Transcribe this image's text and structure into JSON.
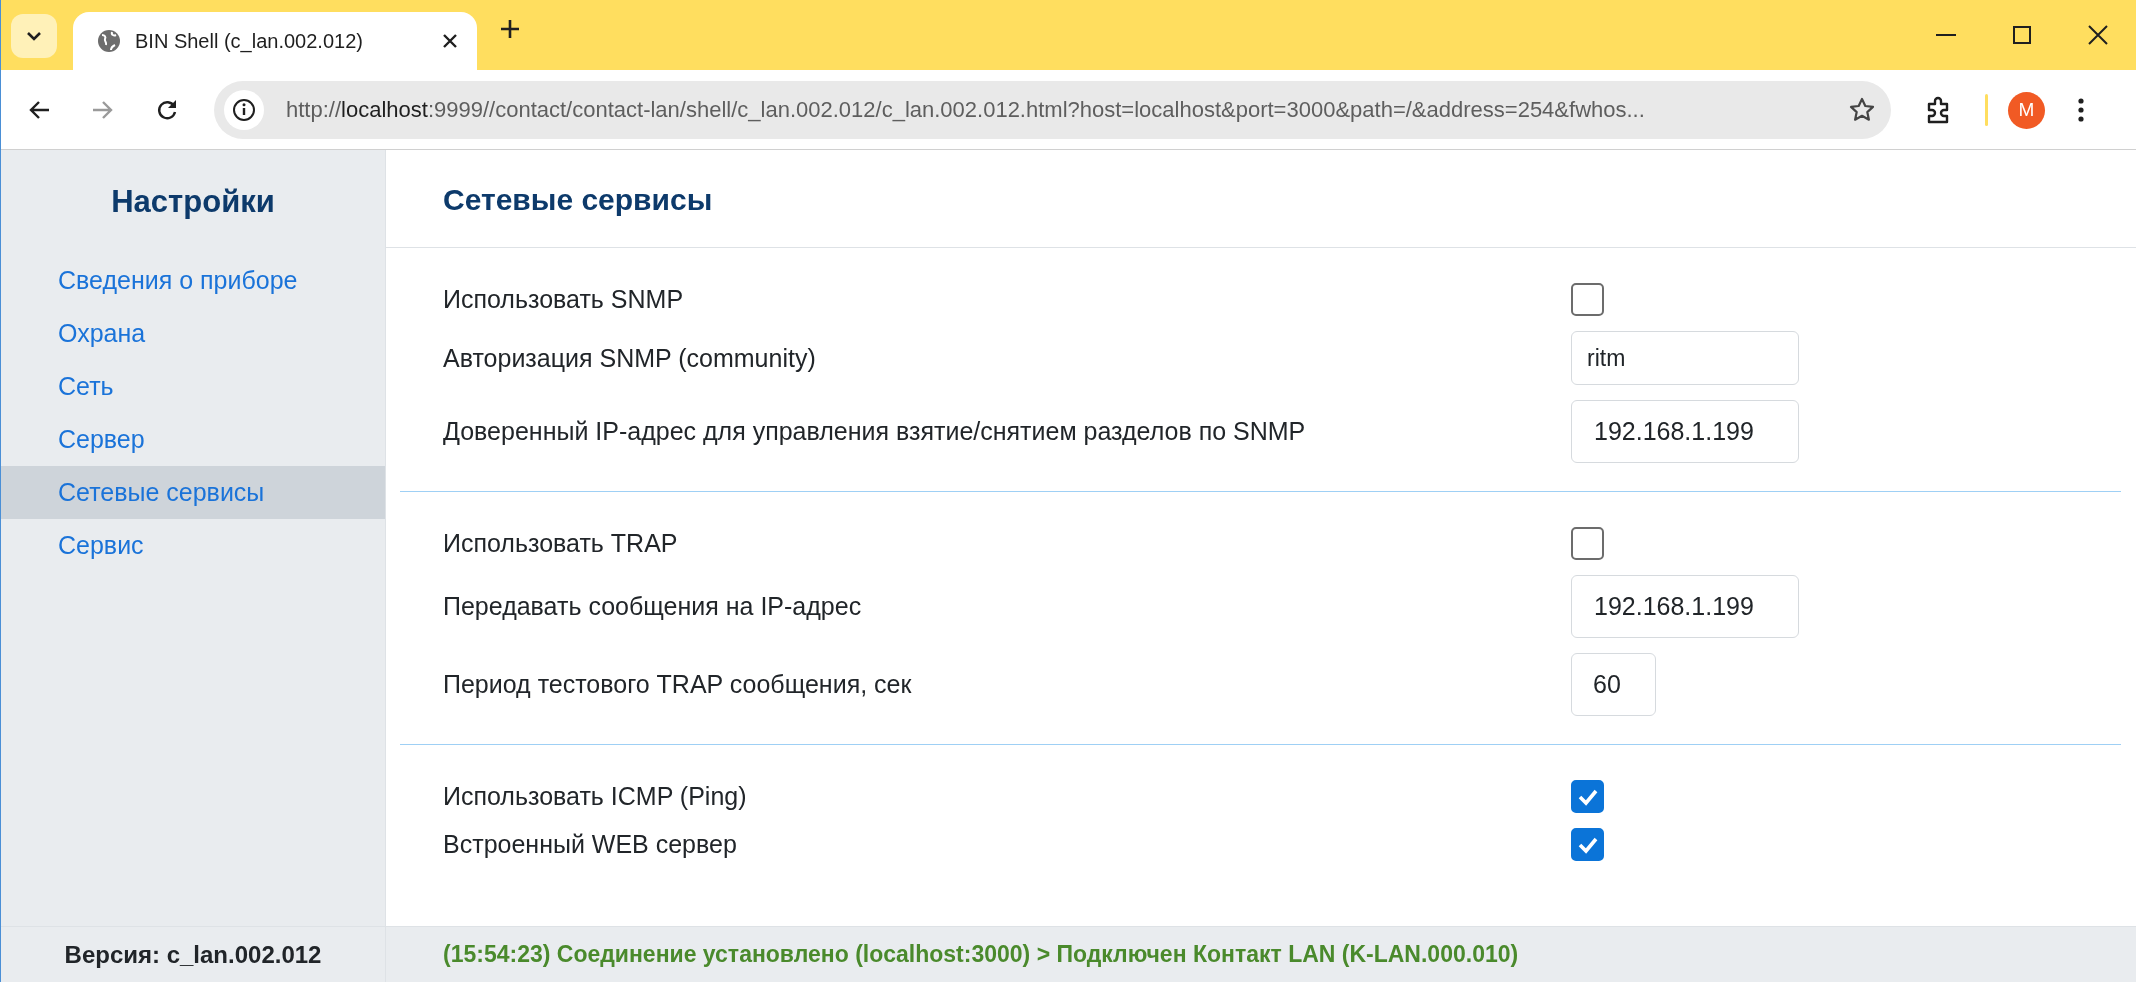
{
  "browser": {
    "tab_title": "BIN Shell (c_lan.002.012)",
    "address": {
      "scheme": "http://",
      "host": "localhost",
      "rest": ":9999//contact/contact-lan/shell/c_lan.002.012/c_lan.002.012.html?host=localhost&port=3000&path=/&address=254&fwhos..."
    },
    "forward_disabled": true,
    "avatar": "M"
  },
  "sidebar": {
    "title": "Настройки",
    "items": [
      {
        "label": "Сведения о приборе",
        "selected": false
      },
      {
        "label": "Охрана",
        "selected": false
      },
      {
        "label": "Сеть",
        "selected": false
      },
      {
        "label": "Сервер",
        "selected": false
      },
      {
        "label": "Сетевые сервисы",
        "selected": true
      },
      {
        "label": "Сервис",
        "selected": false
      }
    ],
    "version": "Версия: c_lan.002.012"
  },
  "content": {
    "title": "Сетевые сервисы",
    "sections": [
      {
        "rows": [
          {
            "kind": "checkbox",
            "label": "Использовать SNMP",
            "checked": false
          },
          {
            "kind": "text",
            "label": "Авторизация SNMP (community)",
            "value": "ritm"
          },
          {
            "kind": "ip",
            "label": "Доверенный IP-адрес для управления взятие/снятием разделов по SNMP",
            "value": "192.168.1.199"
          }
        ]
      },
      {
        "rows": [
          {
            "kind": "checkbox",
            "label": "Использовать TRAP",
            "checked": false
          },
          {
            "kind": "ip",
            "label": "Передавать сообщения на IP-адрес",
            "value": "192.168.1.199"
          },
          {
            "kind": "number",
            "label": "Период тестового TRAP сообщения, сек",
            "value": "60"
          }
        ]
      },
      {
        "rows": [
          {
            "kind": "checkbox",
            "label": "Использовать ICMP (Ping)",
            "checked": true
          },
          {
            "kind": "checkbox",
            "label": "Встроенный WEB сервер",
            "checked": true
          }
        ]
      }
    ]
  },
  "status_bar": "(15:54:23) Соединение установлено (localhost:3000) > Подключен Контакт LAN (K-LAN.000.010)"
}
